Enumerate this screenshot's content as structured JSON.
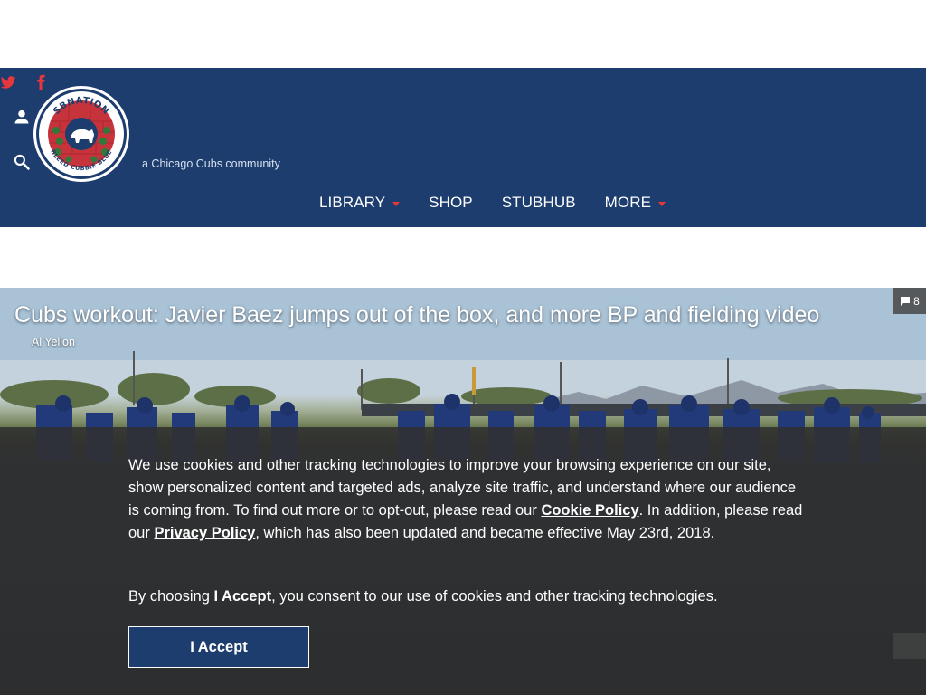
{
  "header": {
    "tagline": "a Chicago Cubs community",
    "social": [
      {
        "name": "twitter",
        "icon": "twitter-icon"
      },
      {
        "name": "facebook",
        "icon": "facebook-icon"
      }
    ],
    "logo": {
      "top_text": "SBNATION",
      "bottom_text": "BLEED CUBBIE BLUE"
    },
    "nav": [
      {
        "label": "LIBRARY",
        "dropdown": true
      },
      {
        "label": "SHOP",
        "dropdown": false
      },
      {
        "label": "STUBHUB",
        "dropdown": false
      },
      {
        "label": "MORE",
        "dropdown": true
      }
    ]
  },
  "article": {
    "title": "Cubs workout: Javier Baez jumps out of the box, and more BP and fielding video",
    "author": "Al Yellon",
    "comment_count": "8"
  },
  "cookie_banner": {
    "text_1": "We use cookies and other tracking technologies to improve your browsing experience on our site, show personalized content and targeted ads, analyze site traffic, and understand where our audience is coming from. To find out more or to opt-out, please read our ",
    "cookie_policy_link": "Cookie Policy",
    "text_2": ". In addition, please read our ",
    "privacy_policy_link": "Privacy Policy",
    "text_3": ", which has also been updated and became effective May 23rd, 2018.",
    "consent_prefix": "By choosing ",
    "consent_bold": "I Accept",
    "consent_suffix": ", you consent to our use of cookies and other tracking technologies.",
    "accept_label": "I Accept"
  },
  "colors": {
    "brand_blue": "#1d3d6e",
    "accent_red": "#e5373c",
    "overlay": "#303030"
  }
}
